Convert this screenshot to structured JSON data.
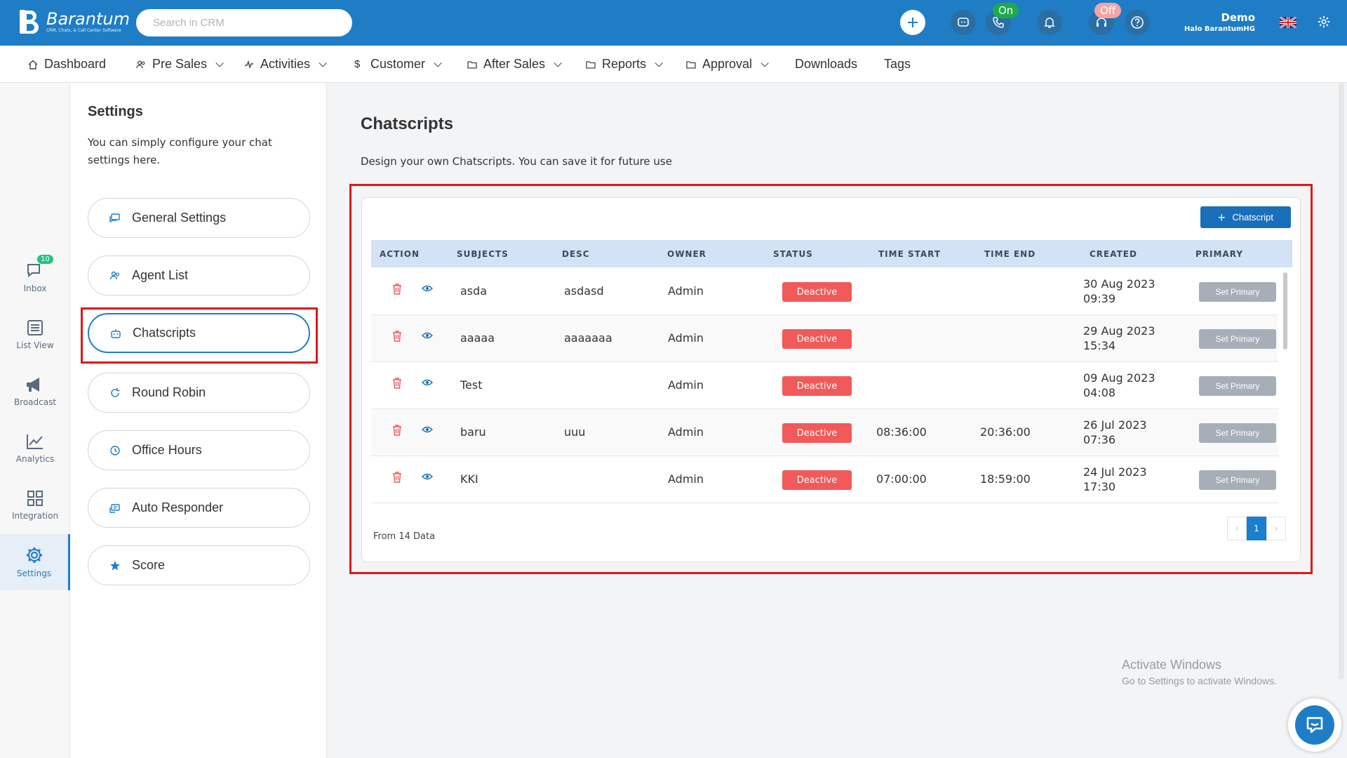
{
  "brand": {
    "name": "Barantum",
    "tagline": "CRM, Chats, & Call Center Software"
  },
  "search": {
    "placeholder": "Search in CRM"
  },
  "topbar": {
    "status_on": "On",
    "status_off": "Off",
    "user_name": "Demo",
    "user_org": "Halo BarantumHG",
    "accent": "#1f7dc6"
  },
  "nav": [
    {
      "label": "Dashboard",
      "icon": "home-icon",
      "dropdown": false
    },
    {
      "label": "Pre Sales",
      "icon": "users-icon",
      "dropdown": true
    },
    {
      "label": "Activities",
      "icon": "activity-icon",
      "dropdown": true
    },
    {
      "label": "Customer",
      "icon": "dollar-icon",
      "dropdown": true
    },
    {
      "label": "After Sales",
      "icon": "folder-icon",
      "dropdown": true
    },
    {
      "label": "Reports",
      "icon": "folder-icon",
      "dropdown": true
    },
    {
      "label": "Approval",
      "icon": "folder-icon",
      "dropdown": true
    },
    {
      "label": "Downloads",
      "icon": "",
      "dropdown": false
    },
    {
      "label": "Tags",
      "icon": "",
      "dropdown": false
    }
  ],
  "rail": [
    {
      "label": "Inbox",
      "icon": "chat-icon",
      "badge": "10"
    },
    {
      "label": "List View",
      "icon": "list-icon"
    },
    {
      "label": "Broadcast",
      "icon": "megaphone-icon"
    },
    {
      "label": "Analytics",
      "icon": "chart-icon"
    },
    {
      "label": "Integration",
      "icon": "grid-icon"
    },
    {
      "label": "Settings",
      "icon": "gear-icon",
      "active": true
    }
  ],
  "settings": {
    "title": "Settings",
    "description": "You can simply configure your chat settings here.",
    "items": [
      {
        "label": "General Settings",
        "icon": "chat-bubble-icon"
      },
      {
        "label": "Agent List",
        "icon": "users-icon"
      },
      {
        "label": "Chatscripts",
        "icon": "robot-icon",
        "active": true
      },
      {
        "label": "Round Robin",
        "icon": "refresh-icon"
      },
      {
        "label": "Office Hours",
        "icon": "clock-icon"
      },
      {
        "label": "Auto Responder",
        "icon": "reply-icon"
      },
      {
        "label": "Score",
        "icon": "star-icon"
      }
    ]
  },
  "main": {
    "title": "Chatscripts",
    "description": "Design your own Chatscripts. You can save it for future use",
    "add_button": "Chatscript",
    "columns": [
      "ACTION",
      "SUBJECTS",
      "DESC",
      "OWNER",
      "STATUS",
      "TIME START",
      "TIME END",
      "CREATED",
      "PRIMARY"
    ],
    "rows": [
      {
        "subject": "asda",
        "desc": "asdasd",
        "owner": "Admin",
        "status": "Deactive",
        "time_start": "",
        "time_end": "",
        "created_date": "30 Aug 2023",
        "created_time": "09:39",
        "primary": "Set Primary"
      },
      {
        "subject": "aaaaa",
        "desc": "aaaaaaa",
        "owner": "Admin",
        "status": "Deactive",
        "time_start": "",
        "time_end": "",
        "created_date": "29 Aug 2023",
        "created_time": "15:34",
        "primary": "Set Primary"
      },
      {
        "subject": "Test",
        "desc": "",
        "owner": "Admin",
        "status": "Deactive",
        "time_start": "",
        "time_end": "",
        "created_date": "09 Aug 2023",
        "created_time": "04:08",
        "primary": "Set Primary"
      },
      {
        "subject": "baru",
        "desc": "uuu",
        "owner": "Admin",
        "status": "Deactive",
        "time_start": "08:36:00",
        "time_end": "20:36:00",
        "created_date": "26 Jul 2023",
        "created_time": "07:36",
        "primary": "Set Primary"
      },
      {
        "subject": "KKI",
        "desc": "",
        "owner": "Admin",
        "status": "Deactive",
        "time_start": "07:00:00",
        "time_end": "18:59:00",
        "created_date": "24 Jul 2023",
        "created_time": "17:30",
        "primary": "Set Primary"
      }
    ],
    "footer": "From 14 Data",
    "pagination": {
      "prev": "‹",
      "current": "1",
      "next": "›"
    },
    "status_color": "#f25959"
  },
  "watermark": {
    "line1": "Activate Windows",
    "line2": "Go to Settings to activate Windows."
  }
}
